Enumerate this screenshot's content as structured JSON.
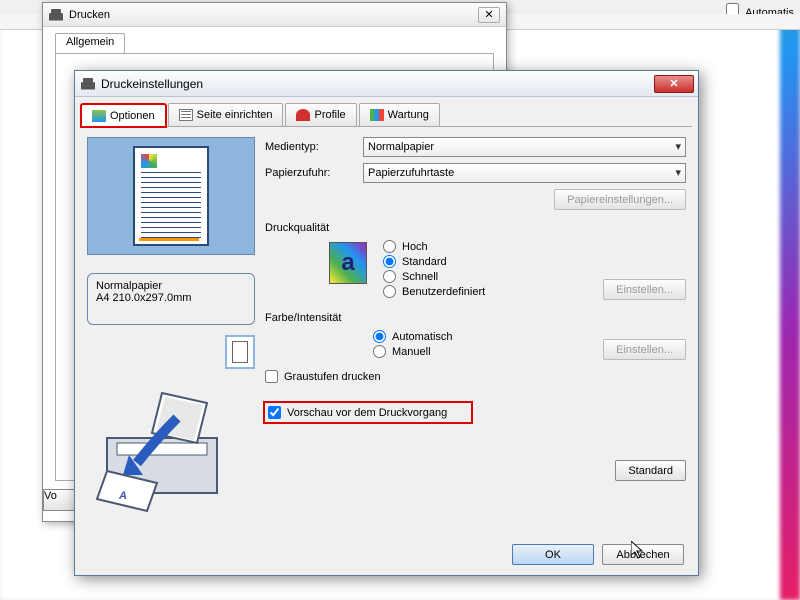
{
  "top_toolbar": {
    "checkbox_label": "Automatis"
  },
  "back_dialog": {
    "title": "Drucken",
    "tab": "Allgemein",
    "partial_button": "Vo"
  },
  "dialog": {
    "title": "Druckeinstellungen",
    "tabs": {
      "options": "Optionen",
      "page_setup": "Seite einrichten",
      "profiles": "Profile",
      "maintenance": "Wartung"
    }
  },
  "left": {
    "paper_type": "Normalpapier",
    "paper_size": "A4 210.0x297.0mm"
  },
  "right": {
    "media_label": "Medientyp:",
    "media_value": "Normalpapier",
    "source_label": "Papierzufuhr:",
    "source_value": "Papierzufuhrtaste",
    "paper_settings_btn": "Papiereinstellungen...",
    "quality_label": "Druckqualität",
    "quality": {
      "high": "Hoch",
      "standard": "Standard",
      "fast": "Schnell",
      "custom": "Benutzerdefiniert"
    },
    "einstellen": "Einstellen...",
    "color_label": "Farbe/Intensität",
    "color": {
      "auto": "Automatisch",
      "manual": "Manuell"
    },
    "grayscale": "Graustufen drucken",
    "preview": "Vorschau vor dem Druckvorgang",
    "standard_btn": "Standard"
  },
  "footer": {
    "ok": "OK",
    "cancel": "Abbrechen"
  }
}
